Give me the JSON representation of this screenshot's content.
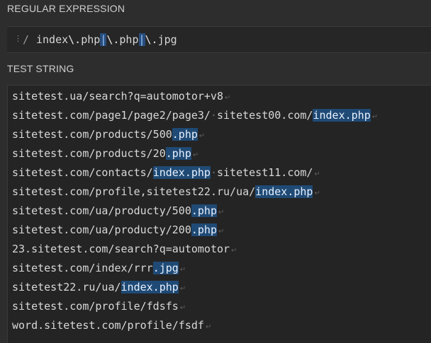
{
  "regex_section": {
    "title": "REGULAR EXPRESSION",
    "delimiter": "/",
    "pattern_parts": [
      {
        "text": "index",
        "kind": "literal"
      },
      {
        "text": "\\.",
        "kind": "escape"
      },
      {
        "text": "php",
        "kind": "literal"
      },
      {
        "text": "|",
        "kind": "alt"
      },
      {
        "text": "\\.",
        "kind": "escape"
      },
      {
        "text": "php",
        "kind": "literal"
      },
      {
        "text": "|",
        "kind": "alt"
      },
      {
        "text": "\\.",
        "kind": "escape"
      },
      {
        "text": "jpg",
        "kind": "literal"
      }
    ]
  },
  "test_section": {
    "title": "TEST STRING",
    "lines": [
      [
        {
          "t": "sitetest.ua/search?q=automotor+v8"
        }
      ],
      [
        {
          "t": "sitetest.com/page1/page2/page3/"
        },
        {
          "t": " ",
          "ws": true
        },
        {
          "t": "sitetest00.com/"
        },
        {
          "t": "index.php",
          "m": true
        }
      ],
      [
        {
          "t": "sitetest.com/products/500"
        },
        {
          "t": ".php",
          "m": true
        }
      ],
      [
        {
          "t": "sitetest.com/products/20"
        },
        {
          "t": ".php",
          "m": true
        }
      ],
      [
        {
          "t": "sitetest.com/contacts/"
        },
        {
          "t": "index.php",
          "m": true
        },
        {
          "t": " ",
          "ws": true
        },
        {
          "t": "sitetest11.com/"
        }
      ],
      [
        {
          "t": "sitetest.com/profile,sitetest22.ru/ua/"
        },
        {
          "t": "index.php",
          "m": true
        }
      ],
      [
        {
          "t": "sitetest.com/ua/producty/500"
        },
        {
          "t": ".php",
          "m": true
        }
      ],
      [
        {
          "t": "sitetest.com/ua/producty/200"
        },
        {
          "t": ".php",
          "m": true
        }
      ],
      [
        {
          "t": "23.sitetest.com/search?q=automotor"
        }
      ],
      [
        {
          "t": "sitetest.com/index/rrr"
        },
        {
          "t": ".jpg",
          "m": true
        }
      ],
      [
        {
          "t": "sitetest22.ru/ua/"
        },
        {
          "t": "index.php",
          "m": true
        }
      ],
      [
        {
          "t": "sitetest.com/profile/fdsfs"
        }
      ],
      [
        {
          "t": "word.sitetest.com/profile/fsdf"
        }
      ]
    ]
  },
  "colors": {
    "background": "#2d2d2e",
    "match_highlight": "#1f4a75",
    "alternation_highlight": "#274e7c"
  },
  "icons": {
    "drag_handle": "drag-handle-icon",
    "line_end": "return-arrow-icon"
  }
}
